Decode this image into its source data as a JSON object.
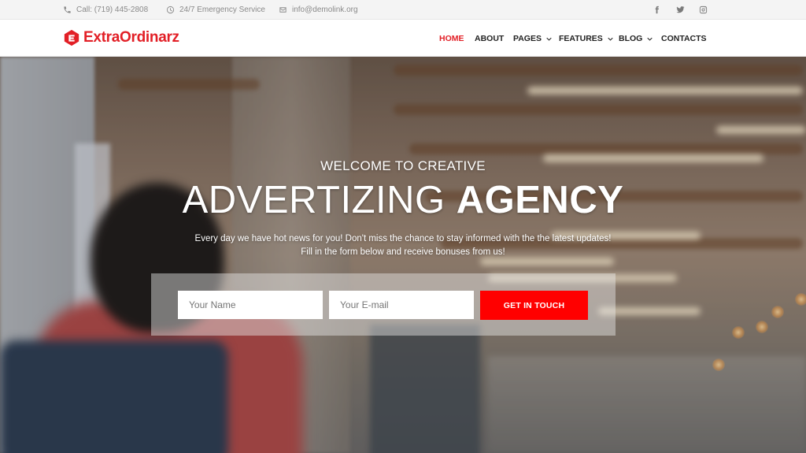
{
  "topbar": {
    "phone": "Call: (719) 445-2808",
    "service": "24/7 Emergency Service",
    "email": "info@demolink.org",
    "social": [
      "facebook-icon",
      "twitter-icon",
      "instagram-icon"
    ]
  },
  "brand": {
    "name": "ExtraOrdinarz",
    "color": "#e21f26"
  },
  "nav": {
    "items": [
      {
        "label": "HOME",
        "active": true,
        "dropdown": false
      },
      {
        "label": "ABOUT",
        "active": false,
        "dropdown": false
      },
      {
        "label": "PAGES",
        "active": false,
        "dropdown": true
      },
      {
        "label": "FEATURES",
        "active": false,
        "dropdown": true
      },
      {
        "label": "BLOG",
        "active": false,
        "dropdown": true
      },
      {
        "label": "CONTACTS",
        "active": false,
        "dropdown": false
      }
    ]
  },
  "hero": {
    "welcome": "WELCOME TO CREATIVE",
    "headline_thin": "ADVERTIZING",
    "headline_bold": "AGENCY",
    "intro_line1": "Every day we have hot news for you! Don't miss the chance to stay informed with the the latest updates!",
    "intro_line2": "Fill in the form below and receive bonuses from us!"
  },
  "form": {
    "name_placeholder": "Your Name",
    "email_placeholder": "Your E-mail",
    "submit_label": "GET IN TOUCH",
    "submit_color": "#ff0000"
  }
}
